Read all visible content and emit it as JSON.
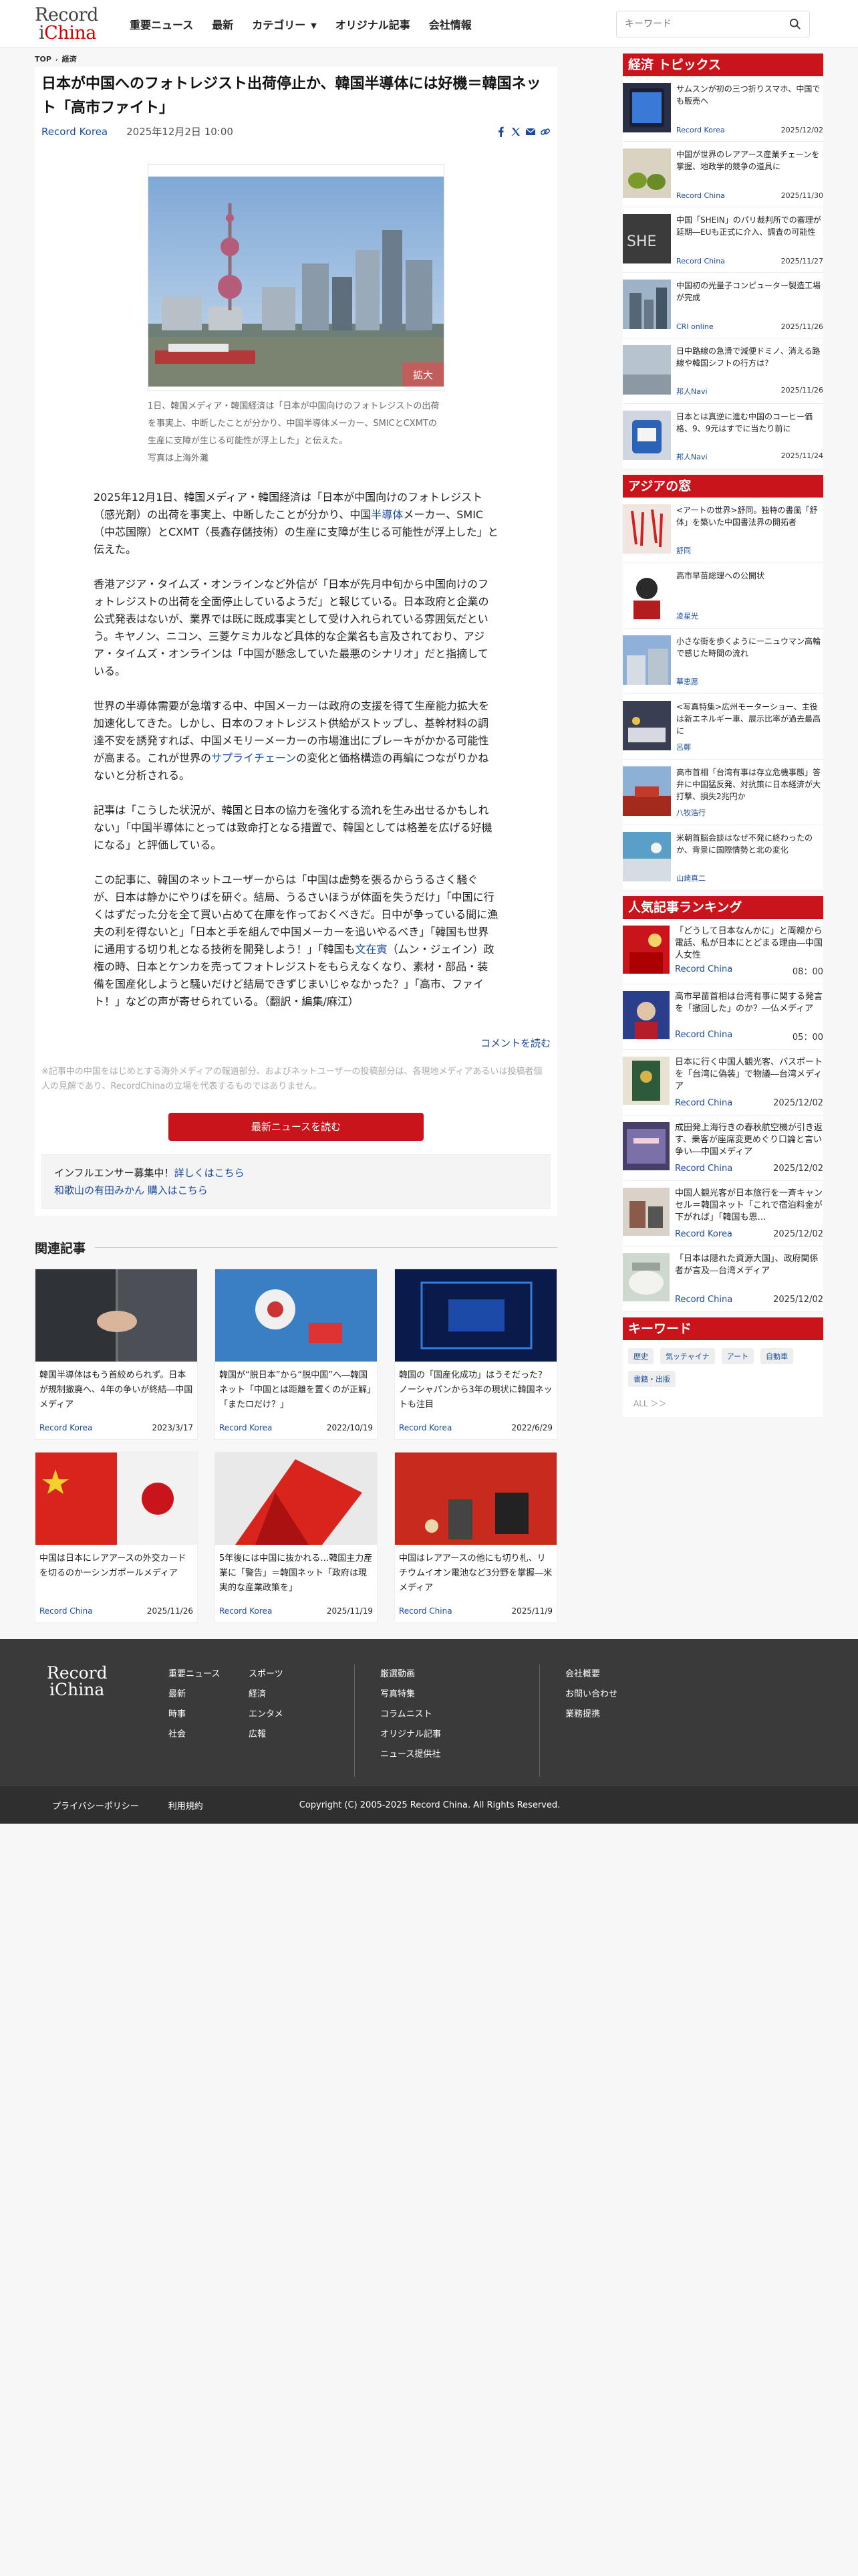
{
  "header": {
    "logo_line1": "Record",
    "logo_line2_a": "i",
    "logo_line2_b": "China",
    "nav": [
      "重要ニュース",
      "最新",
      "カテゴリー",
      "オリジナル記事",
      "会社情報"
    ],
    "search_placeholder": "キーワード"
  },
  "breadcrumb": [
    "TOP",
    "経済"
  ],
  "article": {
    "title": "日本が中国へのフォトレジスト出荷停止か、韓国半導体には好機＝韓国ネット「高市ファイト」",
    "source": "Record Korea",
    "date": "2025年12月2日 10:00",
    "photo_zoom": "拡大",
    "caption": "1日、韓国メディア・韓国経済は「日本が中国向けのフォトレジストの出荷を事実上、中断したことが分かり、中国半導体メーカー、SMICとCXMTの生産に支障が生じる可能性が浮上した」と伝えた。",
    "caption_credit": "写真は上海外灘",
    "p1": "2025年12月1日、韓国メディア・韓国経済は「日本が中国向けのフォトレジスト（感光剤）の出荷を事実上、中断したことが分かり、中国",
    "p1_link": "半導体",
    "p1_b": "メーカー、SMIC（中芯国際）とCXMT（長鑫存儲技術）の生産に支障が生じる可能性が浮上した」と伝えた。",
    "p2": "香港アジア・タイムズ・オンラインなど外信が「日本が先月中旬から中国向けのフォトレジストの出荷を全面停止しているようだ」と報じている。日本政府と企業の公式発表はないが、業界では既に既成事実として受け入れられている雰囲気だという。キヤノン、ニコン、三菱ケミカルなど具体的な企業名も言及されており、アジア・タイムズ・オンラインは「中国が懸念していた最悪のシナリオ」だと指摘している。",
    "p3": "世界の半導体需要が急増する中、中国メーカーは政府の支援を得て生産能力拡大を加速化してきた。しかし、日本のフォトレジスト供給がストップし、基幹材料の調達不安を誘発すれば、中国メモリーメーカーの市場進出にブレーキがかかる可能性が高まる。これが世界の",
    "p3_link": "サプライチェーン",
    "p3_b": "の変化と価格構造の再編につながりかねないと分析される。",
    "p4": "記事は「こうした状況が、韓国と日本の協力を強化する流れを生み出せるかもしれない」「中国半導体にとっては致命打となる措置で、韓国としては格差を広げる好機になる」と評価している。",
    "p5": "この記事に、韓国のネットユーザーからは「中国は虚勢を張るからうるさく騒ぐが、日本は静かにやりばを研ぐ。結局、うるさいほうが体面を失うだけ」「中国に行くはずだった分を全て買い占めて在庫を作っておくべきだ。日中が争っている間に漁夫の利を得ないと」「日本と手を組んで中国メーカーを追いやるべき」「韓国も世界に通用する切り札となる技術を開発しよう！」「韓国も",
    "p5_link": "文在寅",
    "p5_b": "（ムン・ジェイン）政権の時、日本とケンカを売ってフォトレジストをもらえなくなり、素材・部品・装備を国産化しようと騒いだけど結局できずじまいじゃなかった？」「高市、ファイト！」などの声が寄せられている。（翻訳・編集/麻江）",
    "comment_link": "コメントを読む",
    "disclaimer": "※記事中の中国をはじめとする海外メディアの報道部分、およびネットユーザーの投稿部分は、各現地メディアあるいは投稿者個人の見解であり、RecordChinaの立場を代表するものではありません。",
    "btn_latest": "最新ニュースを読む",
    "info1": "インフルエンサー募集中！",
    "info1_link": "詳しくはこちら",
    "info2_link": "和歌山の有田みかん 購入はこちら"
  },
  "related": {
    "title": "関連記事",
    "items": [
      {
        "title": "韓国半導体はもう首絞められず。日本が規制撤廃へ、4年の争いが終結―中国メディア",
        "source": "Record Korea",
        "date": "2023/3/17"
      },
      {
        "title": "韓国が“脱日本”から“脱中国”へ―韓国ネット「中国とは距離を置くのが正解」「またロだけ？」",
        "source": "Record Korea",
        "date": "2022/10/19"
      },
      {
        "title": "韓国の「国産化成功」はうそだった？ノーシャパンから3年の現状に韓国ネットも注目",
        "source": "Record Korea",
        "date": "2022/6/29"
      },
      {
        "title": "中国は日本にレアアースの外交カードを切るのかーシンガポールメディア",
        "source": "Record China",
        "date": "2025/11/26"
      },
      {
        "title": "5年後には中国に抜かれる…韓国主力産業に「警告」＝韓国ネット「政府は現実的な産業政策を」",
        "source": "Record Korea",
        "date": "2025/11/19"
      },
      {
        "title": "中国はレアアースの他にも切り札、リチウムイオン電池など3分野を掌握―米メディア",
        "source": "Record China",
        "date": "2025/11/9"
      }
    ]
  },
  "sidebar": {
    "economy_title": "経済 トピックス",
    "economy": [
      {
        "title": "サムスンが初の三つ折りスマホ、中国でも販売へ",
        "source": "Record Korea",
        "date": "2025/12/02"
      },
      {
        "title": "中国が世界のレアアース産業チェーンを掌握、地政学的競争の道具に",
        "source": "Record China",
        "date": "2025/11/30"
      },
      {
        "title": "中国「SHEIN」のパリ裁判所での審理が延期―EUも正式に介入、調査の可能性",
        "source": "Record China",
        "date": "2025/11/27"
      },
      {
        "title": "中国初の光量子コンピューター製造工場が完成",
        "source": "CRI online",
        "date": "2025/11/26"
      },
      {
        "title": "日中路線の急滑で減便ドミノ、消える路線や韓国シフトの行方は？",
        "source": "邦人Navi",
        "date": "2025/11/26"
      },
      {
        "title": "日本とは真逆に進む中国のコーヒー価格、9、9元はすでに当たり前に",
        "source": "邦人Navi",
        "date": "2025/11/24"
      }
    ],
    "asia_title": "アジアの窓",
    "asia": [
      {
        "title": "<アートの世界>舒同。独特の書風「舒体」を築いた中国書法界の開拓者",
        "source": "舒同"
      },
      {
        "title": "高市早苗総理への公開状",
        "source": "凌星光"
      },
      {
        "title": "小さな街を歩くようにーニュウマン高輪で感じた時間の流れ",
        "source": "華恵愿"
      },
      {
        "title": "<写真特集>広州モーターショー、主役は新エネルギー車、展示比率が過去最高に",
        "source": "呂鄭"
      },
      {
        "title": "高市首相「台湾有事は存立危機事態」答弁に中国猛反発、対抗策に日本経済が大打撃、損失2兆円か",
        "source": "八牧浩行"
      },
      {
        "title": "米朝首脳会談はなぜ不発に終わったのか、背景に国際情勢と北の変化",
        "source": "山崎真二"
      }
    ],
    "ranking_title": "人気記事ランキング",
    "ranking": [
      {
        "title": "「どうして日本なんかに」と両親から電話、私が日本にとどまる理由―中国人女性",
        "source": "Record China",
        "date": "08：00"
      },
      {
        "title": "高市早苗首相は台湾有事に関する発言を「撤回した」のか？―仏メディア",
        "source": "Record China",
        "date": "05：00"
      },
      {
        "title": "日本に行く中国人観光客、パスポートを「台湾に偽装」で物議―台湾メディア",
        "source": "Record China",
        "date": "2025/12/02"
      },
      {
        "title": "成田発上海行きの春秋航空機が引き返す、乗客が座席変更めぐり口論と言い争い―中国メディア",
        "source": "Record China",
        "date": "2025/12/02"
      },
      {
        "title": "中国人観光客が日本旅行を一斉キャンセル＝韓国ネット「これで宿泊料金が下がれば」「韓国も恩…",
        "source": "Record Korea",
        "date": "2025/12/02"
      },
      {
        "title": "「日本は隠れた資源大国」、政府関係者が言及―台湾メディア",
        "source": "Record China",
        "date": "2025/12/02"
      }
    ],
    "keyword_title": "キーワード",
    "keywords": [
      "歴史",
      "気ッチャイナ",
      "アート",
      "自動車",
      "書籍・出版"
    ],
    "keyword_all": "ALL ＞＞"
  },
  "footer": {
    "logo_line1": "Record",
    "logo_line2": "iChina",
    "col1": [
      "重要ニュース",
      "最新",
      "時事",
      "社会"
    ],
    "col2": [
      "スポーツ",
      "経済",
      "エンタメ",
      "広報"
    ],
    "col3": [
      "厳選動画",
      "写真特集",
      "コラムニスト",
      "オリジナル記事",
      "ニュース提供社"
    ],
    "col4": [
      "会社概要",
      "お問い合わせ",
      "業務提携"
    ],
    "privacy": "プライバシーポリシー",
    "terms": "利用規約",
    "copyright": "Copyright (C) 2005-2025 Record China. All Rights Reserved."
  }
}
